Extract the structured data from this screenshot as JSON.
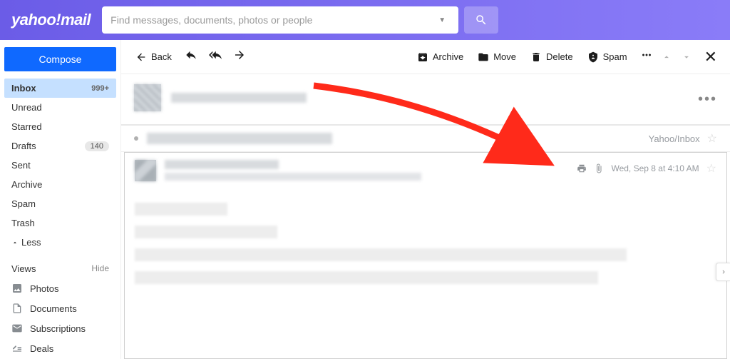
{
  "header": {
    "logo_text": "yahoo!mail",
    "search_placeholder": "Find messages, documents, photos or people"
  },
  "sidebar": {
    "compose": "Compose",
    "folders": [
      {
        "label": "Inbox",
        "count": "999+",
        "active": true
      },
      {
        "label": "Unread"
      },
      {
        "label": "Starred"
      },
      {
        "label": "Drafts",
        "pill": "140"
      },
      {
        "label": "Sent"
      },
      {
        "label": "Archive"
      },
      {
        "label": "Spam"
      },
      {
        "label": "Trash"
      }
    ],
    "less": "Less",
    "views_label": "Views",
    "hide_label": "Hide",
    "views": [
      {
        "label": "Photos"
      },
      {
        "label": "Documents"
      },
      {
        "label": "Subscriptions"
      },
      {
        "label": "Deals"
      }
    ]
  },
  "toolbar": {
    "back": "Back",
    "archive": "Archive",
    "move": "Move",
    "delete": "Delete",
    "spam": "Spam"
  },
  "message": {
    "location": "Yahoo/Inbox",
    "timestamp": "Wed, Sep 8 at 4:10 AM"
  }
}
